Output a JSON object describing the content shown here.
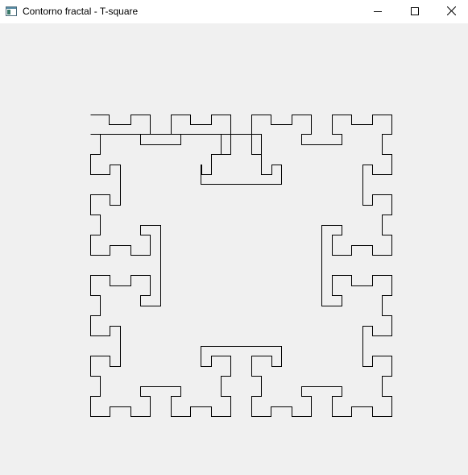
{
  "window": {
    "title": "Contorno fractal - T-square",
    "icon": "app-window-icon",
    "controls": {
      "minimize_icon": "minimize-icon",
      "maximize_icon": "maximize-icon",
      "close_icon": "close-icon"
    }
  },
  "canvas": {
    "background": "#f0f0f0",
    "stroke_color": "#000000",
    "figure": "fractal-outline"
  }
}
